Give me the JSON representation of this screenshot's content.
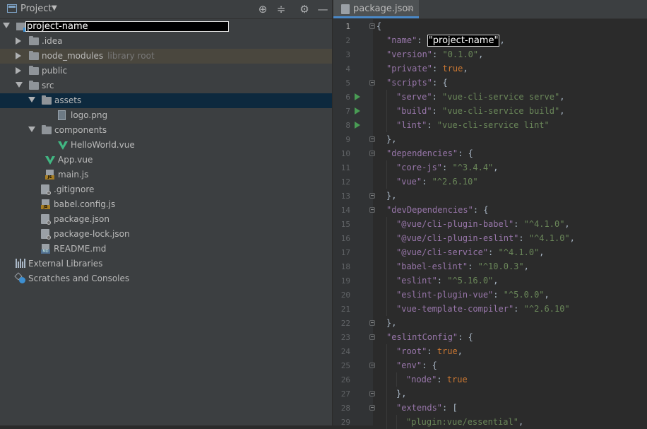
{
  "project_pane": {
    "title": "Project",
    "toolbar_icons": [
      "locate-icon",
      "collapse-all-icon",
      "gear-icon",
      "minimize-icon"
    ],
    "tree": [
      {
        "label": "project-name",
        "hint": "",
        "depth": 0,
        "type": "project-root",
        "expanded": true,
        "redacted": true
      },
      {
        "label": ".idea",
        "hint": "",
        "depth": 1,
        "type": "folder",
        "expanded": false
      },
      {
        "label": "node_modules",
        "hint": "library root",
        "depth": 1,
        "type": "folder",
        "expanded": false,
        "highlight": "library"
      },
      {
        "label": "public",
        "hint": "",
        "depth": 1,
        "type": "folder",
        "expanded": false
      },
      {
        "label": "src",
        "hint": "",
        "depth": 1,
        "type": "folder",
        "expanded": true
      },
      {
        "label": "assets",
        "hint": "",
        "depth": 2,
        "type": "folder",
        "expanded": true,
        "selected": true
      },
      {
        "label": "logo.png",
        "hint": "",
        "depth": 3,
        "type": "png"
      },
      {
        "label": "components",
        "hint": "",
        "depth": 2,
        "type": "folder",
        "expanded": true
      },
      {
        "label": "HelloWorld.vue",
        "hint": "",
        "depth": 3,
        "type": "vue"
      },
      {
        "label": "App.vue",
        "hint": "",
        "depth": 2,
        "type": "vue"
      },
      {
        "label": "main.js",
        "hint": "",
        "depth": 2,
        "type": "js"
      },
      {
        "label": ".gitignore",
        "hint": "",
        "depth": 1,
        "type": "cfg"
      },
      {
        "label": "babel.config.js",
        "hint": "",
        "depth": 1,
        "type": "js"
      },
      {
        "label": "package.json",
        "hint": "",
        "depth": 1,
        "type": "cfg"
      },
      {
        "label": "package-lock.json",
        "hint": "",
        "depth": 1,
        "type": "cfg"
      },
      {
        "label": "README.md",
        "hint": "",
        "depth": 1,
        "type": "md"
      },
      {
        "label": "External Libraries",
        "hint": "",
        "depth": 0,
        "type": "libs"
      },
      {
        "label": "Scratches and Consoles",
        "hint": "",
        "depth": 0,
        "type": "scratch"
      }
    ]
  },
  "editor": {
    "tab": {
      "label": "package.json",
      "close": "×"
    },
    "lines": [
      [
        [
          "p",
          "{"
        ]
      ],
      [
        [
          "k",
          "\"name\""
        ],
        [
          "p",
          ": "
        ],
        [
          "r",
          "\"project-name\""
        ],
        [
          "p",
          ","
        ]
      ],
      [
        [
          "k",
          "\"version\""
        ],
        [
          "p",
          ": "
        ],
        [
          "s",
          "\"0.1.0\""
        ],
        [
          "p",
          ","
        ]
      ],
      [
        [
          "k",
          "\"private\""
        ],
        [
          "p",
          ": "
        ],
        [
          "kw",
          "true"
        ],
        [
          "p",
          ","
        ]
      ],
      [
        [
          "k",
          "\"scripts\""
        ],
        [
          "p",
          ": {"
        ]
      ],
      [
        [
          "k",
          "\"serve\""
        ],
        [
          "p",
          ": "
        ],
        [
          "s",
          "\"vue-cli-service serve\""
        ],
        [
          "p",
          ","
        ]
      ],
      [
        [
          "k",
          "\"build\""
        ],
        [
          "p",
          ": "
        ],
        [
          "s",
          "\"vue-cli-service build\""
        ],
        [
          "p",
          ","
        ]
      ],
      [
        [
          "k",
          "\"lint\""
        ],
        [
          "p",
          ": "
        ],
        [
          "s",
          "\"vue-cli-service lint\""
        ]
      ],
      [
        [
          "p",
          "},"
        ]
      ],
      [
        [
          "k",
          "\"dependencies\""
        ],
        [
          "p",
          ": {"
        ]
      ],
      [
        [
          "k",
          "\"core-js\""
        ],
        [
          "p",
          ": "
        ],
        [
          "s",
          "\"^3.4.4\""
        ],
        [
          "p",
          ","
        ]
      ],
      [
        [
          "k",
          "\"vue\""
        ],
        [
          "p",
          ": "
        ],
        [
          "s",
          "\"^2.6.10\""
        ]
      ],
      [
        [
          "p",
          "},"
        ]
      ],
      [
        [
          "k",
          "\"devDependencies\""
        ],
        [
          "p",
          ": {"
        ]
      ],
      [
        [
          "k",
          "\"@vue/cli-plugin-babel\""
        ],
        [
          "p",
          ": "
        ],
        [
          "s",
          "\"^4.1.0\""
        ],
        [
          "p",
          ","
        ]
      ],
      [
        [
          "k",
          "\"@vue/cli-plugin-eslint\""
        ],
        [
          "p",
          ": "
        ],
        [
          "s",
          "\"^4.1.0\""
        ],
        [
          "p",
          ","
        ]
      ],
      [
        [
          "k",
          "\"@vue/cli-service\""
        ],
        [
          "p",
          ": "
        ],
        [
          "s",
          "\"^4.1.0\""
        ],
        [
          "p",
          ","
        ]
      ],
      [
        [
          "k",
          "\"babel-eslint\""
        ],
        [
          "p",
          ": "
        ],
        [
          "s",
          "\"^10.0.3\""
        ],
        [
          "p",
          ","
        ]
      ],
      [
        [
          "k",
          "\"eslint\""
        ],
        [
          "p",
          ": "
        ],
        [
          "s",
          "\"^5.16.0\""
        ],
        [
          "p",
          ","
        ]
      ],
      [
        [
          "k",
          "\"eslint-plugin-vue\""
        ],
        [
          "p",
          ": "
        ],
        [
          "s",
          "\"^5.0.0\""
        ],
        [
          "p",
          ","
        ]
      ],
      [
        [
          "k",
          "\"vue-template-compiler\""
        ],
        [
          "p",
          ": "
        ],
        [
          "s",
          "\"^2.6.10\""
        ]
      ],
      [
        [
          "p",
          "},"
        ]
      ],
      [
        [
          "k",
          "\"eslintConfig\""
        ],
        [
          "p",
          ": {"
        ]
      ],
      [
        [
          "k",
          "\"root\""
        ],
        [
          "p",
          ": "
        ],
        [
          "kw",
          "true"
        ],
        [
          "p",
          ","
        ]
      ],
      [
        [
          "k",
          "\"env\""
        ],
        [
          "p",
          ": {"
        ]
      ],
      [
        [
          "k",
          "\"node\""
        ],
        [
          "p",
          ": "
        ],
        [
          "kw",
          "true"
        ]
      ],
      [
        [
          "p",
          "},"
        ]
      ],
      [
        [
          "k",
          "\"extends\""
        ],
        [
          "p",
          ": ["
        ]
      ],
      [
        [
          "s",
          "\"plugin:vue/essential\""
        ],
        [
          "p",
          ","
        ]
      ]
    ],
    "indent": [
      0,
      1,
      1,
      1,
      1,
      2,
      2,
      2,
      1,
      1,
      2,
      2,
      1,
      1,
      2,
      2,
      2,
      2,
      2,
      2,
      2,
      1,
      1,
      2,
      2,
      3,
      2,
      2,
      3
    ],
    "run_lines": [
      6,
      7,
      8
    ],
    "fold_lines": [
      1,
      5,
      9,
      10,
      13,
      14,
      22,
      23,
      25,
      27,
      28
    ]
  }
}
